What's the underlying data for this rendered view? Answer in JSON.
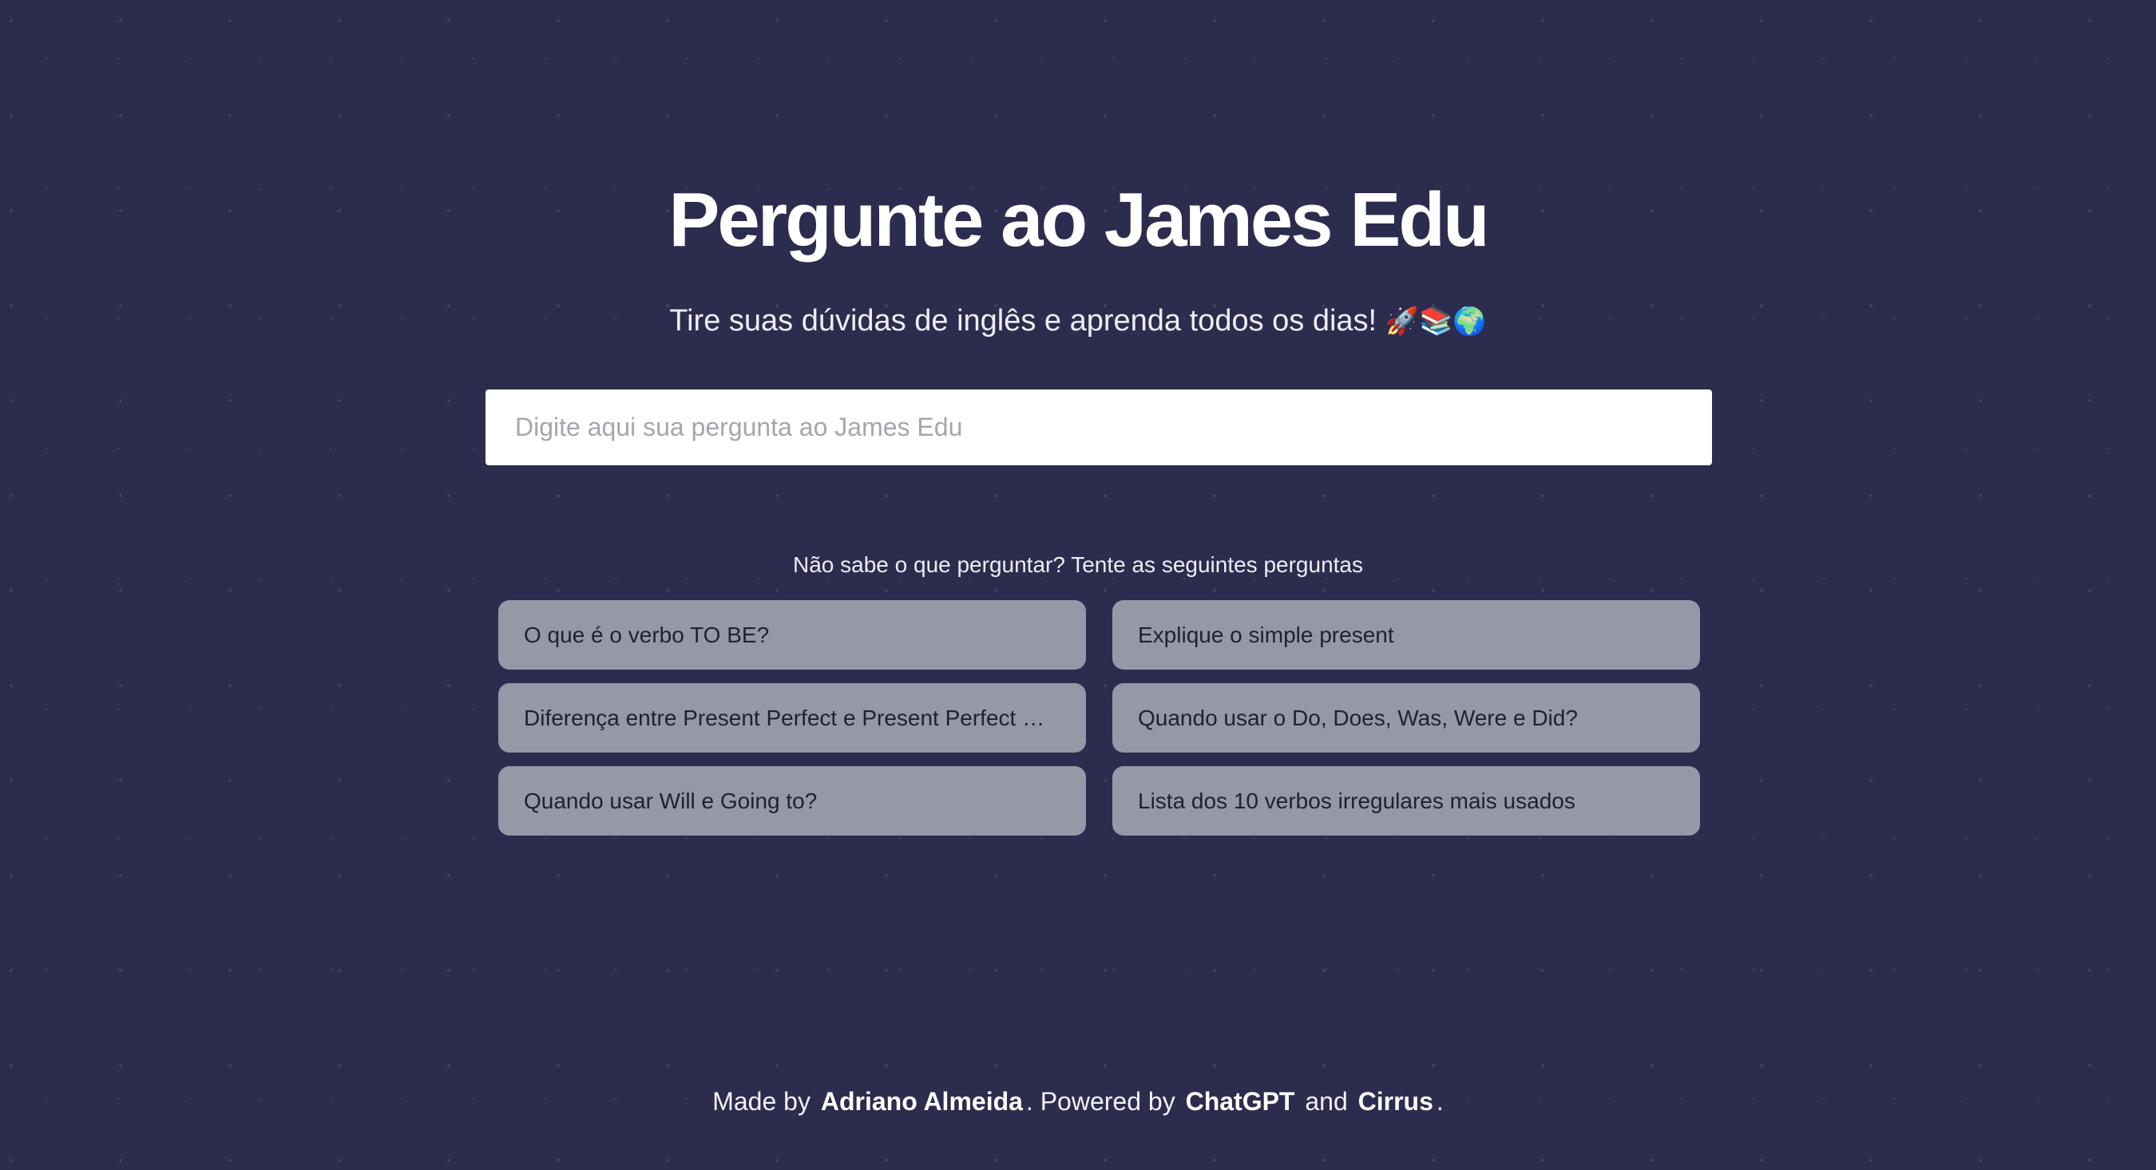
{
  "header": {
    "title": "Pergunte ao James Edu",
    "subtitle": "Tire suas dúvidas de inglês e aprenda todos os dias!",
    "subtitle_emojis": "🚀📚🌍"
  },
  "search": {
    "placeholder": "Digite aqui sua pergunta ao James Edu",
    "value": ""
  },
  "suggestions": {
    "hint": "Não sabe o que perguntar? Tente as seguintes perguntas",
    "items": [
      "O que é o verbo TO BE?",
      "Explique o simple present",
      "Diferença entre Present Perfect e Present Perfect Continuous",
      "Quando usar o Do, Does, Was, Were e Did?",
      "Quando usar Will e Going to?",
      "Lista dos 10 verbos irregulares mais usados"
    ]
  },
  "footer": {
    "made_by_prefix": "Made by",
    "author": "Adriano Almeida",
    "powered_by_prefix": ". Powered by",
    "tech1": "ChatGPT",
    "and": "and",
    "tech2": "Cirrus",
    "suffix": "."
  },
  "colors": {
    "background": "#2b2c4e",
    "suggestion_bg": "#9697a7",
    "input_bg": "#ffffff"
  }
}
